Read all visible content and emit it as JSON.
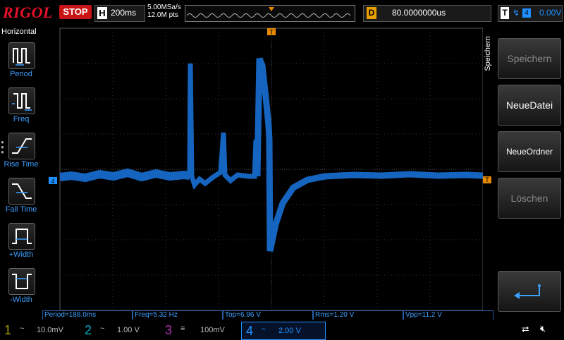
{
  "top": {
    "brand": "RIGOL",
    "run_status": "STOP",
    "horizontal_letter": "H",
    "timebase": "200ms",
    "sample_rate": "5.00MSa/s",
    "memory_depth": "12.0M pts",
    "delay_letter": "D",
    "delay": "80.0000000us",
    "trigger_letter": "T",
    "trigger_source": "4",
    "trigger_level": "0.00V"
  },
  "left": {
    "title": "Horizontal",
    "buttons": [
      {
        "label": "Period",
        "icon": "period-icon"
      },
      {
        "label": "Freq",
        "icon": "freq-icon"
      },
      {
        "label": "Rise Time",
        "icon": "rise-time-icon"
      },
      {
        "label": "Fall Time",
        "icon": "fall-time-icon"
      },
      {
        "label": "+Width",
        "icon": "plus-width-icon"
      },
      {
        "label": "-Width",
        "icon": "minus-width-icon"
      }
    ]
  },
  "right": {
    "title": "Speichern",
    "buttons": [
      "Speichern",
      "NeueDatei",
      "NeueOrdner",
      "Löschen"
    ]
  },
  "measurements": [
    "Period=188.0ms",
    "Freq=5.32 Hz",
    "Top=6.96 V",
    "Rms=1.20 V",
    "Vpp=11.2 V"
  ],
  "channels": [
    {
      "num": "1",
      "coupling": "~",
      "scale": "10.0mV",
      "color": "#d4c000"
    },
    {
      "num": "2",
      "coupling": "~",
      "scale": "1.00 V",
      "color": "#00c8e0"
    },
    {
      "num": "3",
      "coupling": "≡",
      "scale": "100mV",
      "color": "#d040d0"
    },
    {
      "num": "4",
      "coupling": "~",
      "scale": "2.00 V",
      "color": "#1e90ff"
    }
  ],
  "markers": {
    "channel_marker": "4",
    "trigger_marker": "T"
  },
  "colors": {
    "trace": "#1565c0",
    "accent": "#1e90ff",
    "trigger": "#e88a00"
  }
}
